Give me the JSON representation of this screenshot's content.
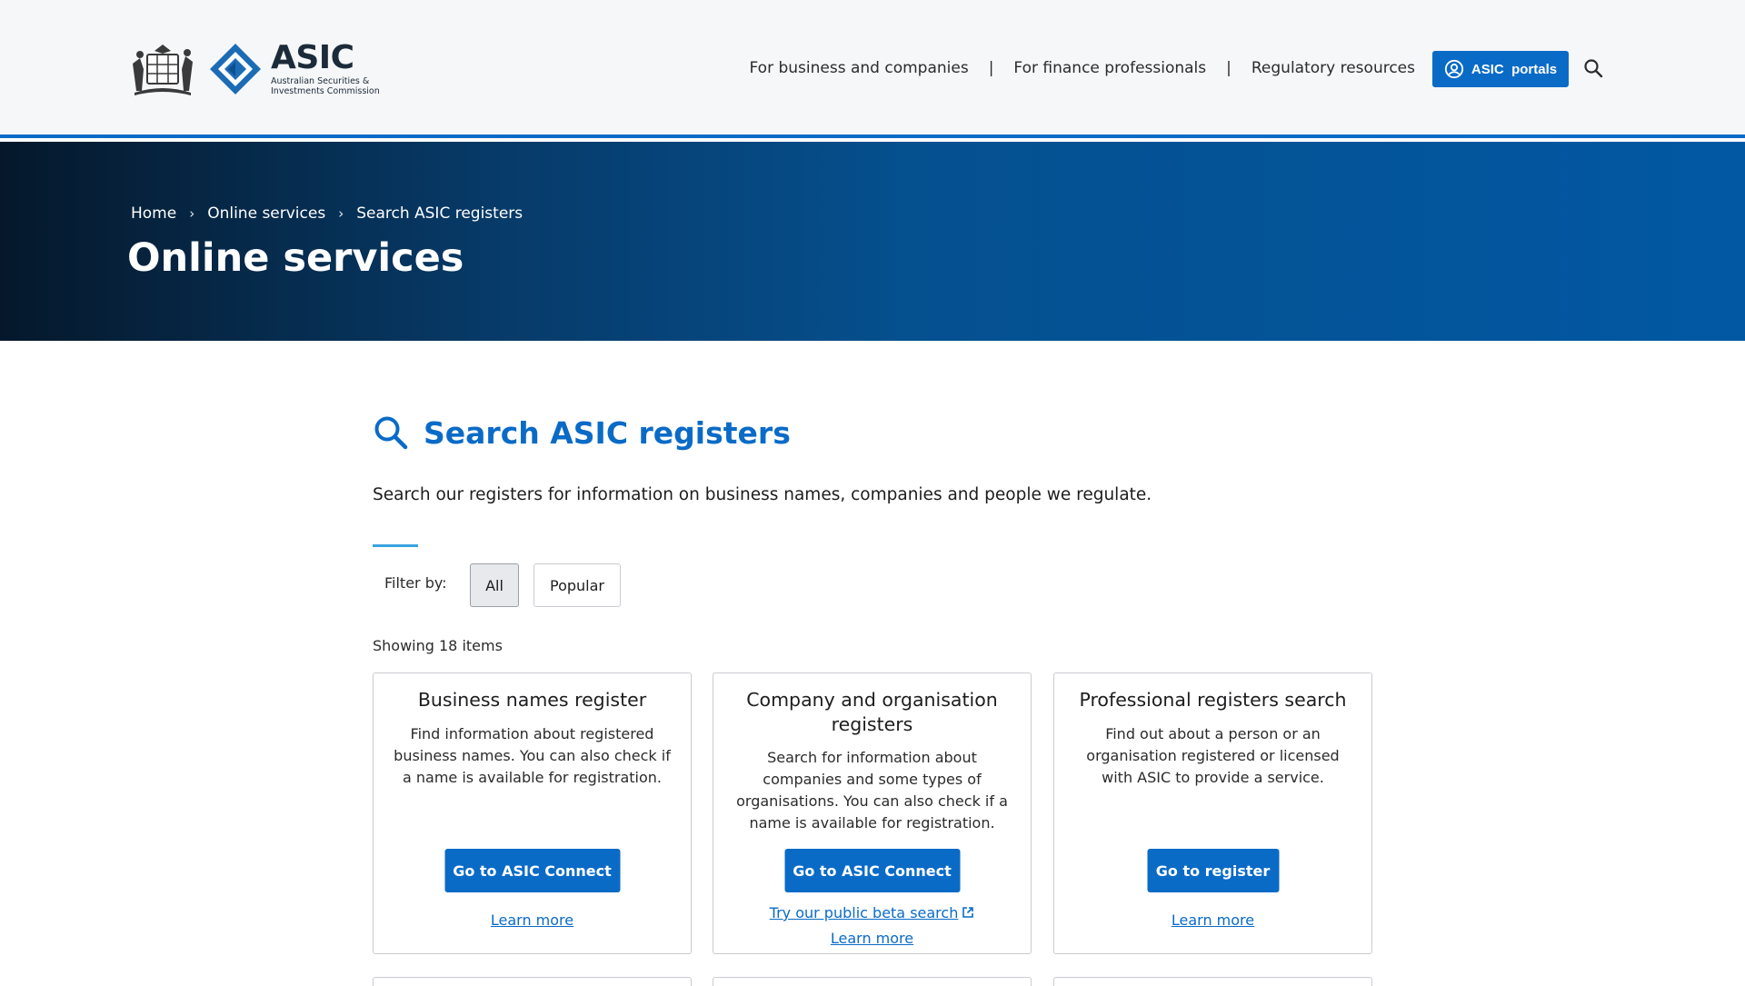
{
  "header": {
    "logo_word": "ASIC",
    "logo_sub_line1": "Australian Securities &",
    "logo_sub_line2": "Investments Commission",
    "nav": [
      {
        "label": "For business and companies"
      },
      {
        "label": "For finance professionals"
      },
      {
        "label": "Regulatory resources"
      }
    ],
    "separator": "|",
    "portals_label": "ASIC  portals",
    "icons": {
      "portals": "user-circle-icon",
      "search": "search-icon"
    }
  },
  "hero": {
    "breadcrumb": [
      {
        "label": "Home"
      },
      {
        "label": "Online services"
      },
      {
        "label": "Search ASIC registers"
      }
    ],
    "chevron": "›",
    "title": "Online services"
  },
  "main": {
    "section_title": "Search ASIC registers",
    "intro": "Search our registers for information on business names, companies and people we regulate.",
    "filter": {
      "label": "Filter by:",
      "options": [
        {
          "label": "All",
          "selected": true
        },
        {
          "label": "Popular",
          "selected": false
        }
      ]
    },
    "count_text": "Showing 18 items",
    "cards": [
      {
        "title": "Business names register",
        "description": "Find information about registered business names. You can also check if a name is available for registration.",
        "button": "Go to ASIC Connect",
        "links": [
          "Learn more"
        ]
      },
      {
        "title": "Company and organisation registers",
        "description": "Search for information about companies and some types of organisations. You can also check if a name is available for registration.",
        "button": "Go to ASIC Connect",
        "links": [
          "Try our public beta search",
          "Learn more"
        ]
      },
      {
        "title": "Professional registers search",
        "description": "Find out about a person or an organisation registered or licensed with ASIC to provide a service.",
        "button": "Go to register",
        "links": [
          "Learn more"
        ]
      }
    ]
  },
  "colors": {
    "brand_blue": "#0a6bc7",
    "hero_dark": "#05182b",
    "hero_light": "#0258a3",
    "accent_line": "#3aa3e0"
  }
}
